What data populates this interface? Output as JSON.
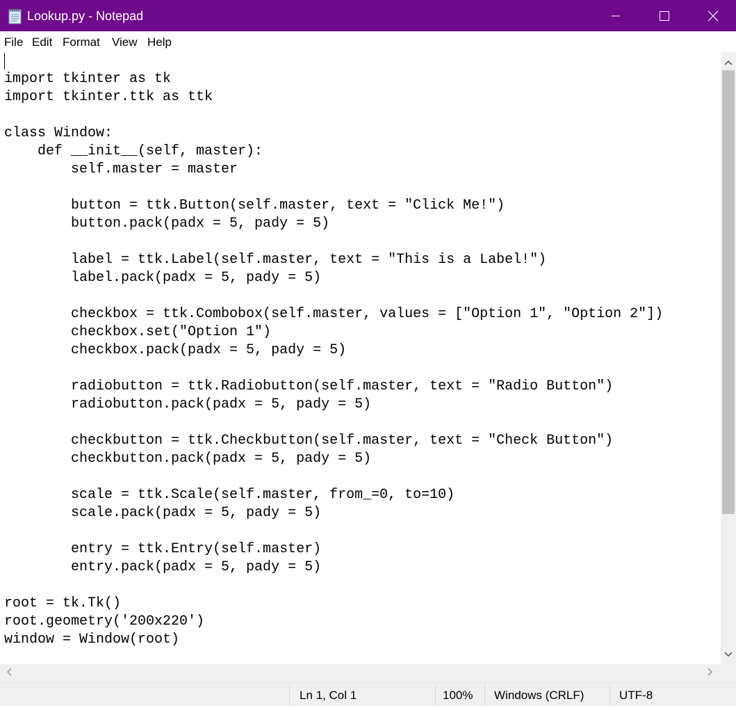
{
  "window": {
    "title": "Lookup.py - Notepad",
    "title_bar_color": "#6f0a8c",
    "controls": {
      "minimize_icon": "minimize-icon",
      "maximize_icon": "maximize-icon",
      "close_icon": "close-icon"
    }
  },
  "menu": {
    "items": [
      "File",
      "Edit",
      "Format",
      "View",
      "Help"
    ]
  },
  "editor": {
    "lines": [
      "",
      "import tkinter as tk",
      "import tkinter.ttk as ttk",
      "",
      "class Window:",
      "    def __init__(self, master):",
      "        self.master = master",
      "",
      "        button = ttk.Button(self.master, text = \"Click Me!\")",
      "        button.pack(padx = 5, pady = 5)",
      "",
      "        label = ttk.Label(self.master, text = \"This is a Label!\")",
      "        label.pack(padx = 5, pady = 5)",
      "",
      "        checkbox = ttk.Combobox(self.master, values = [\"Option 1\", \"Option 2\"])",
      "        checkbox.set(\"Option 1\")",
      "        checkbox.pack(padx = 5, pady = 5)",
      "",
      "        radiobutton = ttk.Radiobutton(self.master, text = \"Radio Button\")",
      "        radiobutton.pack(padx = 5, pady = 5)",
      "",
      "        checkbutton = ttk.Checkbutton(self.master, text = \"Check Button\")",
      "        checkbutton.pack(padx = 5, pady = 5)",
      "",
      "        scale = ttk.Scale(self.master, from_=0, to=10)",
      "        scale.pack(padx = 5, pady = 5)",
      "",
      "        entry = ttk.Entry(self.master)",
      "        entry.pack(padx = 5, pady = 5)",
      "",
      "root = tk.Tk()",
      "root.geometry('200x220')",
      "window = Window(root)"
    ]
  },
  "status": {
    "position": "Ln 1, Col 1",
    "zoom": "100%",
    "line_ending": "Windows (CRLF)",
    "encoding": "UTF-8"
  }
}
